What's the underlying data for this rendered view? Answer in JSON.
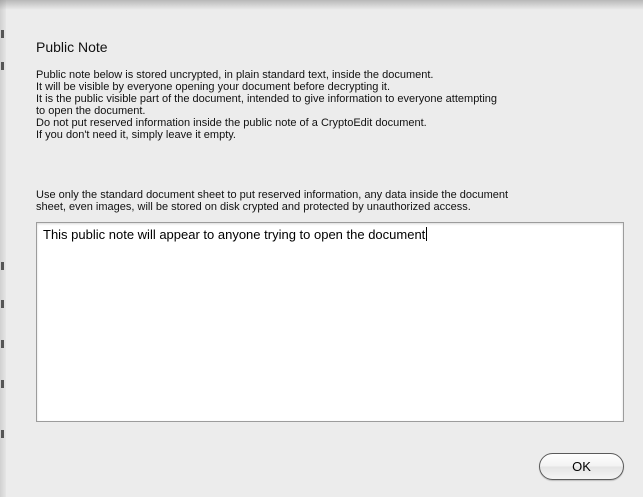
{
  "dialog": {
    "title": "Public Note",
    "paragraph1": [
      "Public note below is stored uncrypted, in plain standard text, inside the document.",
      "It will be visible by everyone opening your document before decrypting it.",
      "It is the public visible part of the document, intended to give information to everyone attempting",
      "to open the document.",
      "Do not put reserved information inside the public note of a CryptoEdit document.",
      "If you don't need it, simply leave it empty."
    ],
    "paragraph2": [
      "Use only the standard document sheet to put reserved information, any data inside the document",
      "sheet, even images, will be stored on disk crypted and protected by unauthorized access."
    ],
    "note_value": "This public note will appear to anyone trying to open the document",
    "ok_label": "OK"
  }
}
